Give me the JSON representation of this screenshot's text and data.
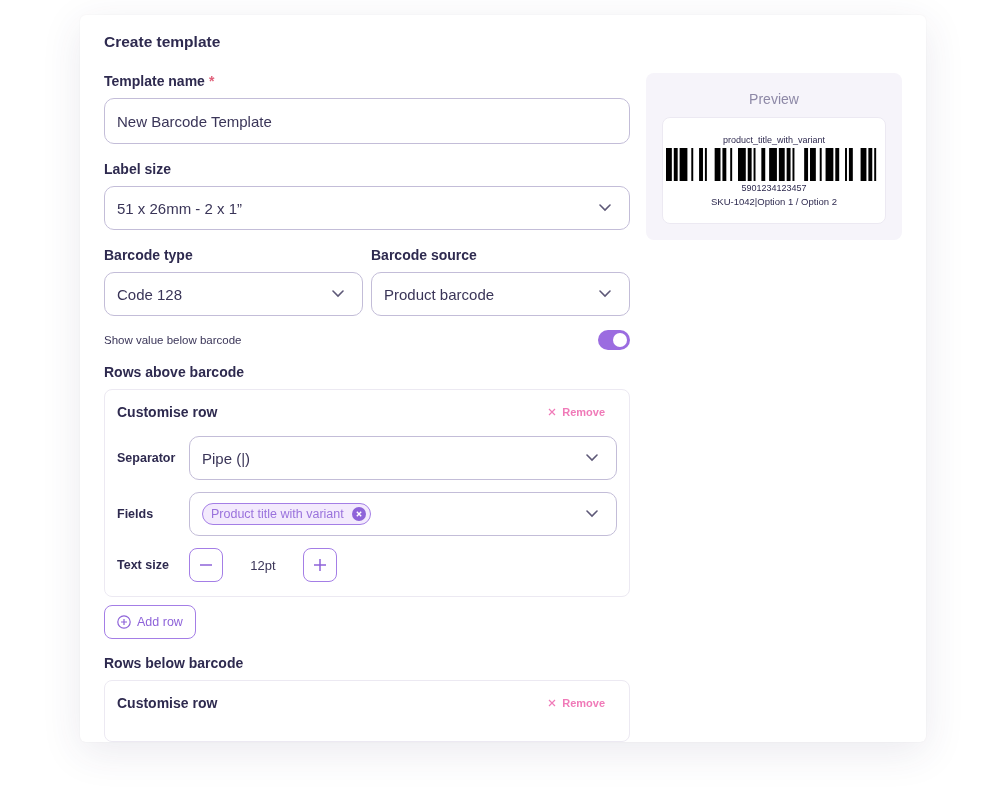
{
  "title": "Create template",
  "template_name": {
    "label": "Template name",
    "required_mark": "*",
    "value": "New Barcode Template"
  },
  "label_size": {
    "label": "Label size",
    "value": "51 x 26mm - 2 x 1”"
  },
  "barcode_type": {
    "label": "Barcode type",
    "value": "Code 128"
  },
  "barcode_source": {
    "label": "Barcode source",
    "value": "Product barcode"
  },
  "show_value_toggle": {
    "label": "Show value below barcode",
    "on": true
  },
  "rows_above": {
    "heading": "Rows above barcode",
    "rows": [
      {
        "title": "Customise row",
        "remove": "Remove",
        "separator": {
          "label": "Separator",
          "value": "Pipe (|)"
        },
        "fields": {
          "label": "Fields",
          "tags": [
            "Product title with variant"
          ]
        },
        "text_size": {
          "label": "Text size",
          "value": "12pt"
        }
      }
    ],
    "add_button": "Add row"
  },
  "rows_below": {
    "heading": "Rows below barcode",
    "rows": [
      {
        "title": "Customise row",
        "remove": "Remove"
      }
    ]
  },
  "preview": {
    "title": "Preview",
    "top_text": "product_title_with_variant",
    "barcode_value": "5901234123457",
    "bottom_text": "SKU-1042|Option 1 / Option 2"
  }
}
